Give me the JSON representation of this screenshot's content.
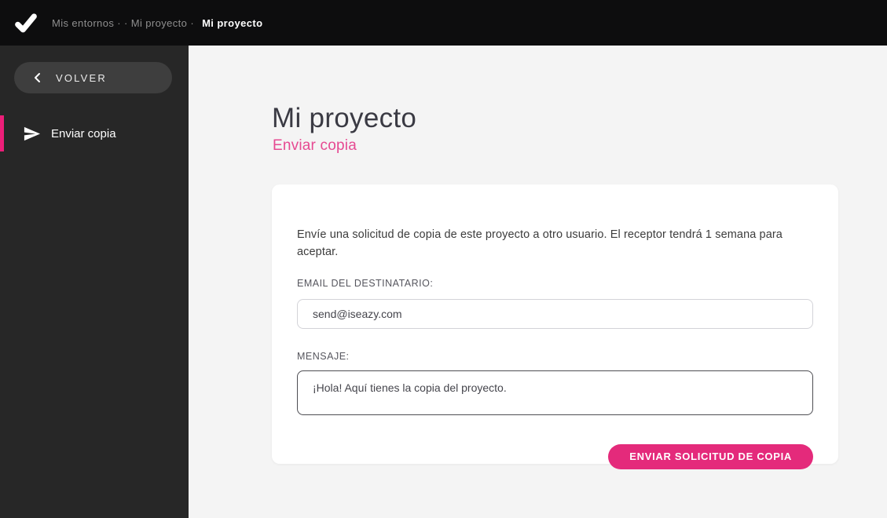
{
  "topbar": {
    "breadcrumb_trail": "Mis entornos ·  · Mi proyecto ·",
    "breadcrumb_current": "Mi proyecto"
  },
  "sidebar": {
    "back_label": "VOLVER",
    "items": [
      {
        "label": "Enviar copia",
        "icon": "send-icon",
        "active": true
      }
    ]
  },
  "main": {
    "title": "Mi proyecto",
    "subtitle": "Enviar copia"
  },
  "card": {
    "description": "Envíe una solicitud de copia de este proyecto a otro usuario. El receptor tendrá 1 semana para aceptar.",
    "email_label": "EMAIL DEL DESTINATARIO:",
    "email_value": "send@iseazy.com",
    "message_label": "MENSAJE:",
    "message_value": "¡Hola! Aquí tienes la copia del proyecto.",
    "submit_label": "ENVIAR SOLICITUD DE COPIA"
  },
  "icons": {
    "logo": "check-icon",
    "back": "chevron-left-icon",
    "nav": "send-icon"
  },
  "colors": {
    "accent_pink": "#e42a7b",
    "subtitle_pink": "#e64a92",
    "indicator_pink": "#ec1e78",
    "topbar_bg": "#0d0d0e",
    "sidebar_bg": "#272727",
    "back_pill_bg": "#3e3e3e",
    "main_bg": "#f4f4f4",
    "card_bg": "#ffffff",
    "title_color": "#3a3a43"
  }
}
